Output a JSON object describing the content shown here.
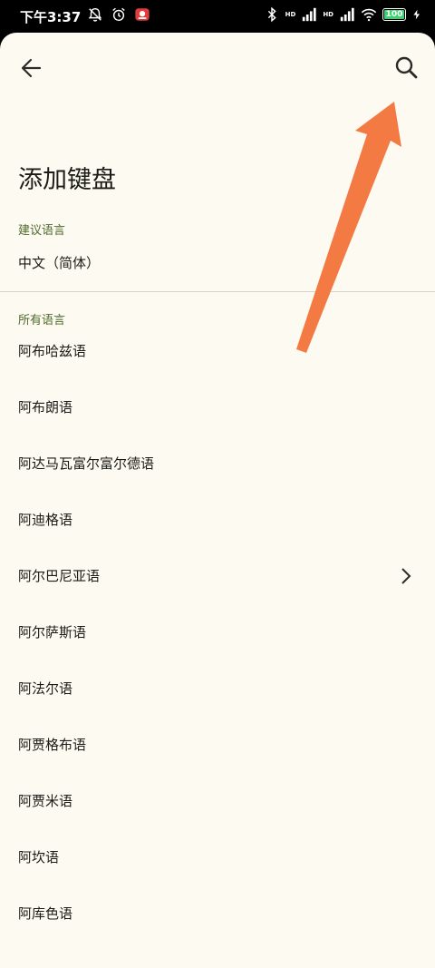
{
  "status_bar": {
    "time": "下午3:37",
    "net1": "HD",
    "net2": "HD",
    "battery": "100"
  },
  "title": "添加键盘",
  "suggested_header": "建议语言",
  "suggested_items": [
    "中文（简体）"
  ],
  "all_header": "所有语言",
  "languages": [
    {
      "label": "阿布哈兹语",
      "has_chevron": false
    },
    {
      "label": "阿布朗语",
      "has_chevron": false
    },
    {
      "label": "阿达马瓦富尔富尔德语",
      "has_chevron": false
    },
    {
      "label": "阿迪格语",
      "has_chevron": false
    },
    {
      "label": "阿尔巴尼亚语",
      "has_chevron": true
    },
    {
      "label": "阿尔萨斯语",
      "has_chevron": false
    },
    {
      "label": "阿法尔语",
      "has_chevron": false
    },
    {
      "label": "阿贾格布语",
      "has_chevron": false
    },
    {
      "label": "阿贾米语",
      "has_chevron": false
    },
    {
      "label": "阿坎语",
      "has_chevron": false
    },
    {
      "label": "阿库色语",
      "has_chevron": false
    }
  ],
  "icons": {
    "back": "back-arrow-icon",
    "search": "search-icon",
    "chevron": "chevron-right-icon"
  },
  "colors": {
    "background": "#fdfaf1",
    "section_header": "#4e6b2c",
    "annotation_arrow": "#f47a44",
    "battery_fill": "#3bd16f"
  }
}
